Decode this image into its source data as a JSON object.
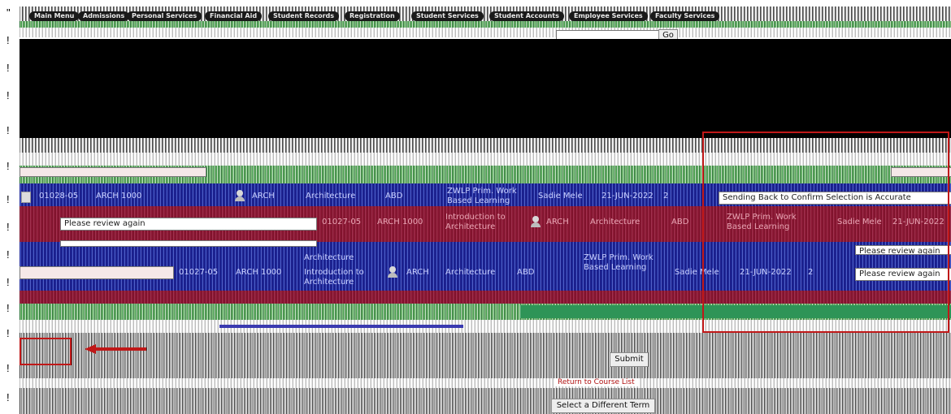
{
  "gutter_marks": [
    "\"",
    "!",
    "!",
    "!",
    "!",
    "!",
    "!",
    "!",
    "!",
    "!",
    "!",
    "!",
    "!",
    "!"
  ],
  "nav": {
    "items": [
      "Main Menu",
      "Admissions",
      "Personal Services",
      "Financial Aid",
      "Student Records",
      "Registration",
      "Student Services",
      "Student Accounts",
      "Employee Services",
      "Faculty Services"
    ]
  },
  "search": {
    "go_label": "Go"
  },
  "rows": [
    {
      "crn": "01027-05",
      "course": "ARCH 1000",
      "title": "Introduction to Architecture",
      "subject": "ARCH",
      "dept": "Architecture",
      "level": "ABD",
      "mode": "ZWLP Prim. Work Based Learning",
      "instructor": "Sadie Mele",
      "date": "21-JUN-2022",
      "count": "2",
      "comment": "Please review again"
    },
    {
      "crn": "01028-05",
      "course": "ARCH 1000",
      "title": "Introduction to Architecture",
      "subject": "ARCH",
      "dept": "Architecture",
      "level": "ABD",
      "mode": "ZWLP Prim. Work Based Learning",
      "instructor": "Sadie Mele",
      "date": "21-JUN-2022",
      "count": "2",
      "comment": "Sending Back to Confirm Selection is Accurate"
    }
  ],
  "footer": {
    "submit_label": "Submit",
    "return_label": "Return to Course List",
    "different_term_label": "Select a Different Term"
  },
  "colors": {
    "highlight": "#c01818",
    "row_blue": "#1f2a9c",
    "row_red": "#8a1834"
  }
}
